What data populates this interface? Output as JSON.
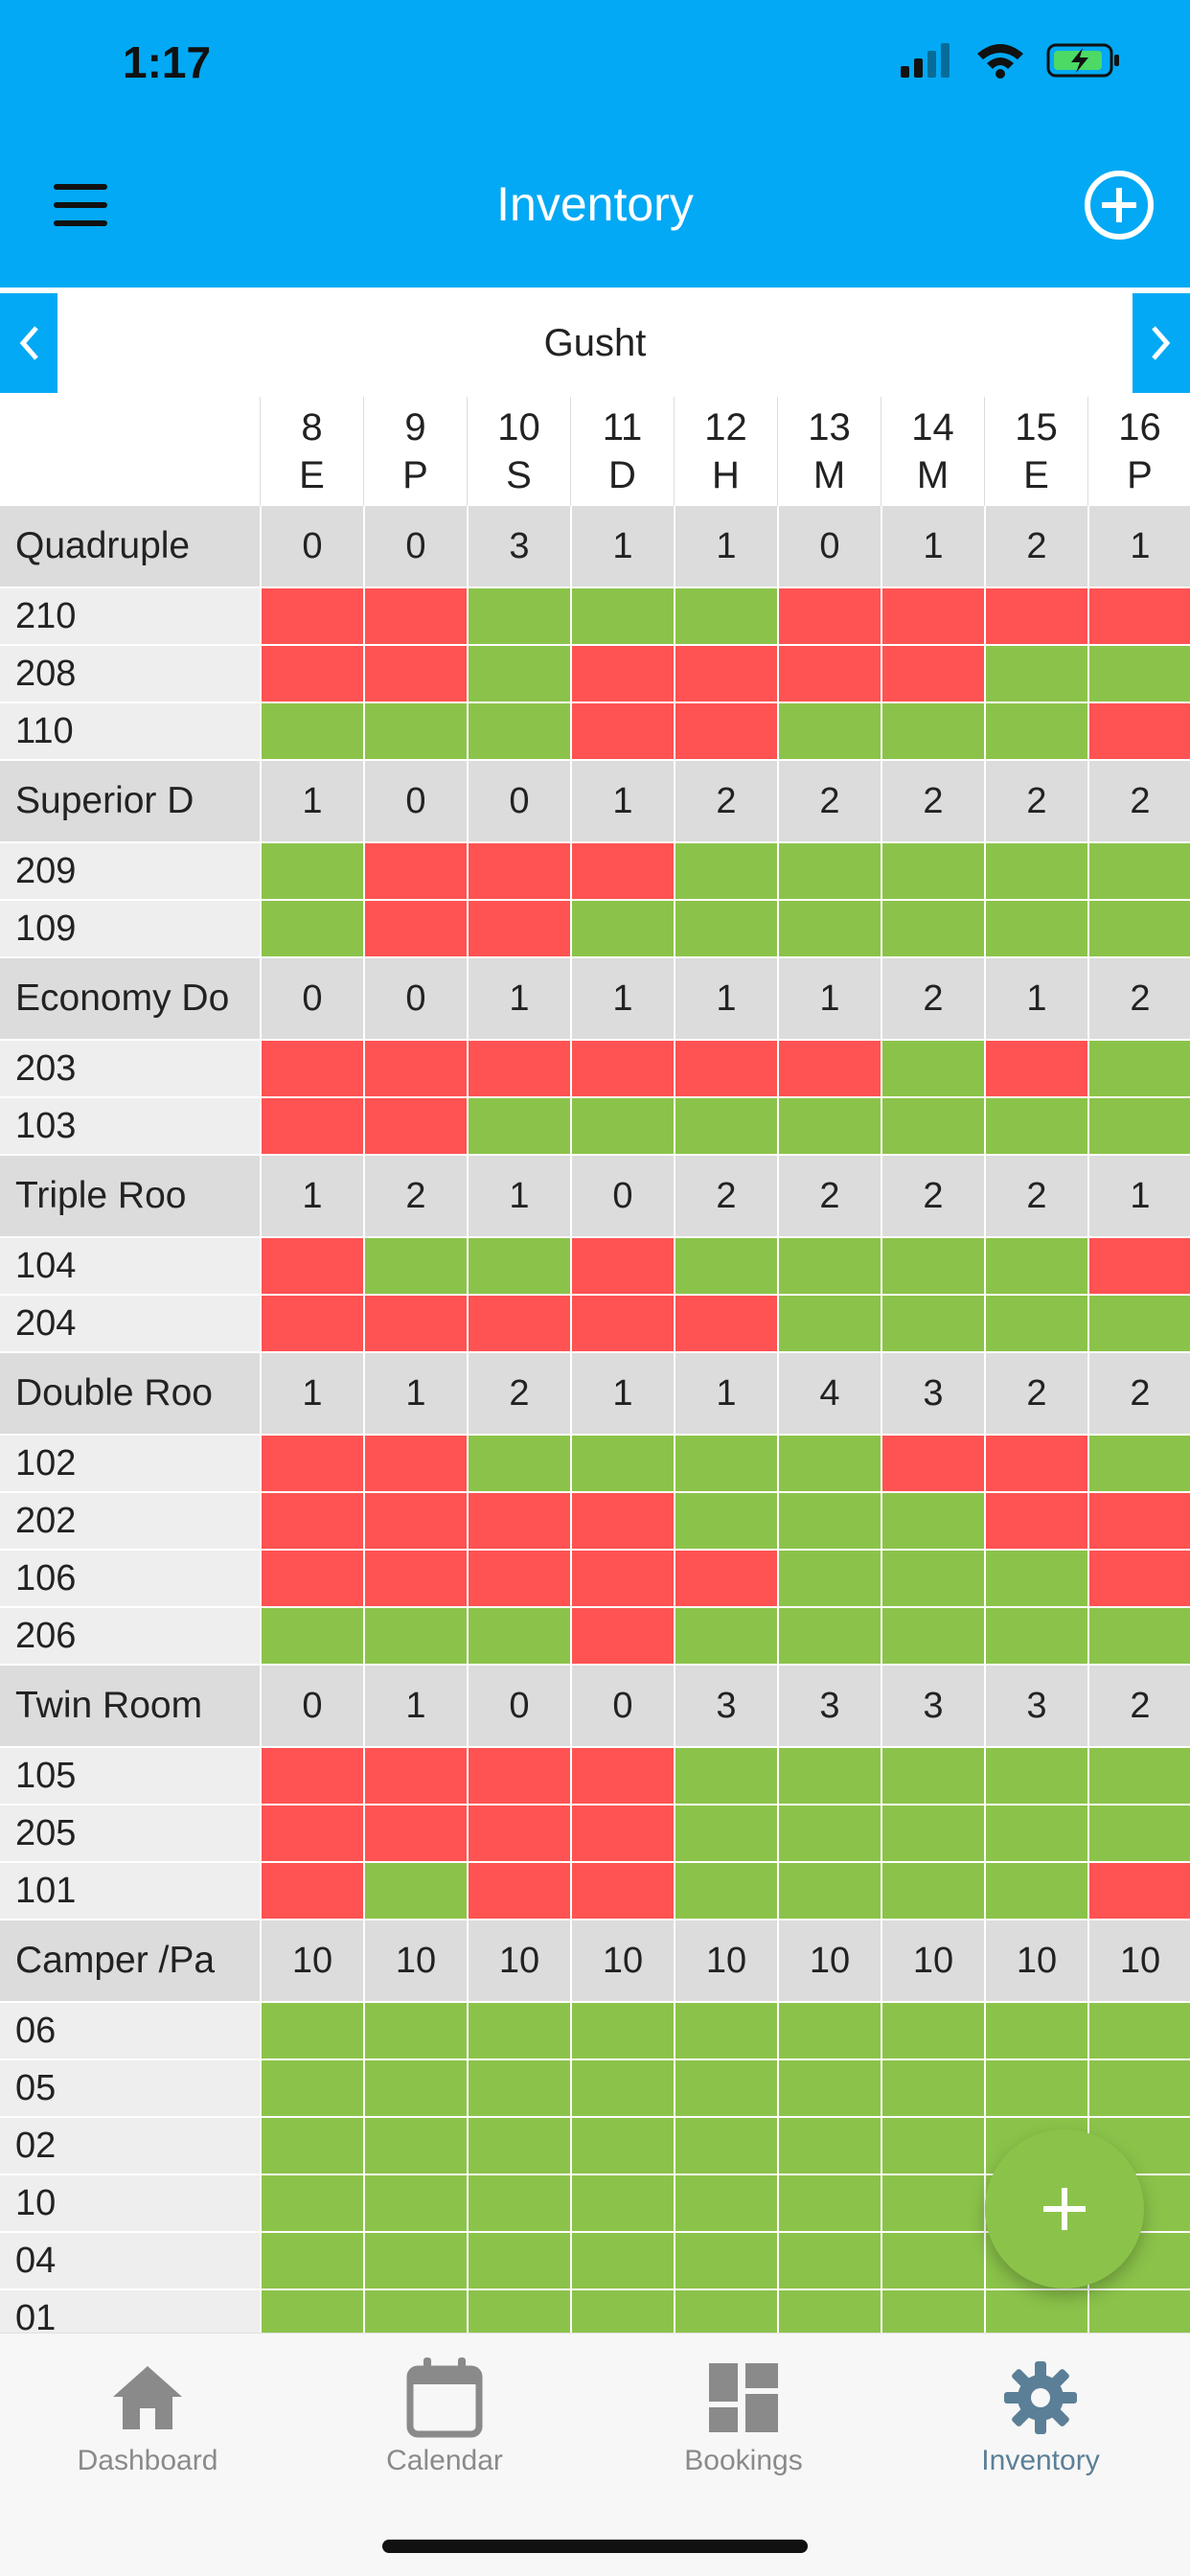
{
  "status_bar": {
    "time": "1:17"
  },
  "app_bar": {
    "title": "Inventory"
  },
  "property_nav": {
    "name": "Gusht"
  },
  "colors": {
    "primary": "#03a9f4",
    "available": "#8bc34a",
    "booked": "#ff5252"
  },
  "days": [
    {
      "num": "8",
      "letter": "E"
    },
    {
      "num": "9",
      "letter": "P"
    },
    {
      "num": "10",
      "letter": "S"
    },
    {
      "num": "11",
      "letter": "D"
    },
    {
      "num": "12",
      "letter": "H"
    },
    {
      "num": "13",
      "letter": "M"
    },
    {
      "num": "14",
      "letter": "M"
    },
    {
      "num": "15",
      "letter": "E"
    },
    {
      "num": "16",
      "letter": "P"
    }
  ],
  "room_types": [
    {
      "name": "Quadruple",
      "counts": [
        "0",
        "0",
        "3",
        "1",
        "1",
        "0",
        "1",
        "2",
        "1"
      ],
      "rooms": [
        {
          "name": "210",
          "status": "BBGGGBBBB"
        },
        {
          "name": "208",
          "status": "BBGBBBBGG"
        },
        {
          "name": "110",
          "status": "GGGBBGGGB"
        }
      ]
    },
    {
      "name": "Superior D",
      "counts": [
        "1",
        "0",
        "0",
        "1",
        "2",
        "2",
        "2",
        "2",
        "2"
      ],
      "rooms": [
        {
          "name": "209",
          "status": "GBBBGGGGG"
        },
        {
          "name": "109",
          "status": "GBBGGGGGG"
        }
      ]
    },
    {
      "name": "Economy Do",
      "counts": [
        "0",
        "0",
        "1",
        "1",
        "1",
        "1",
        "2",
        "1",
        "2"
      ],
      "rooms": [
        {
          "name": "203",
          "status": "BBBBBBGBG"
        },
        {
          "name": "103",
          "status": "BBGGGGGGG"
        }
      ]
    },
    {
      "name": "Triple Roo",
      "counts": [
        "1",
        "2",
        "1",
        "0",
        "2",
        "2",
        "2",
        "2",
        "1"
      ],
      "rooms": [
        {
          "name": "104",
          "status": "BGGBGGGGB"
        },
        {
          "name": "204",
          "status": "BBBBBGGGG"
        }
      ]
    },
    {
      "name": "Double Roo",
      "counts": [
        "1",
        "1",
        "2",
        "1",
        "1",
        "4",
        "3",
        "2",
        "2"
      ],
      "rooms": [
        {
          "name": "102",
          "status": "BBGGGGBBG"
        },
        {
          "name": "202",
          "status": "BBBBGGGBB"
        },
        {
          "name": "106",
          "status": "BBBBBGGGB"
        },
        {
          "name": "206",
          "status": "GGGBGGGGG"
        }
      ]
    },
    {
      "name": "Twin Room",
      "counts": [
        "0",
        "1",
        "0",
        "0",
        "3",
        "3",
        "3",
        "3",
        "2"
      ],
      "rooms": [
        {
          "name": "105",
          "status": "BBBBGGGGG"
        },
        {
          "name": "205",
          "status": "BBBBGGGGG"
        },
        {
          "name": "101",
          "status": "BGBBGGGGB"
        }
      ]
    },
    {
      "name": "Camper /Pa",
      "counts": [
        "10",
        "10",
        "10",
        "10",
        "10",
        "10",
        "10",
        "10",
        "10"
      ],
      "rooms": [
        {
          "name": "06",
          "status": "GGGGGGGGG"
        },
        {
          "name": "05",
          "status": "GGGGGGGGG"
        },
        {
          "name": "02",
          "status": "GGGGGGGGG"
        },
        {
          "name": "10",
          "status": "GGGGGGGGG"
        },
        {
          "name": "04",
          "status": "GGGGGGGGG"
        },
        {
          "name": "01",
          "status": "GGGGGGGGG"
        }
      ]
    }
  ],
  "bottom_nav": {
    "dashboard": "Dashboard",
    "calendar": "Calendar",
    "bookings": "Bookings",
    "inventory": "Inventory"
  }
}
